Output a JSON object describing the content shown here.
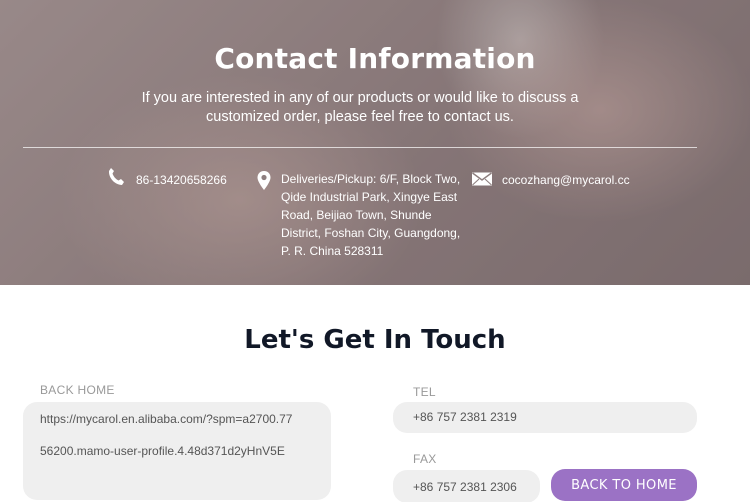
{
  "hero": {
    "title": "Contact Information",
    "subtitle": "If you are interested in any of our products or would like to discuss a customized order, please feel free to contact us.",
    "phone": {
      "icon": "phone-icon",
      "text": "86-13420658266"
    },
    "address": {
      "icon": "map-pin-icon",
      "text": "Deliveries/Pickup:  6/F, Block Two, Qide Industrial Park, Xingye East Road, Beijiao Town, Shunde District, Foshan City, Guangdong, P. R. China 528311"
    },
    "email": {
      "icon": "envelope-icon",
      "text": "cocozhang@mycarol.cc"
    }
  },
  "touch": {
    "title": "Let's Get In Touch",
    "back_home_label": "BACK HOME",
    "back_home_value_line1": "https://mycarol.en.alibaba.com/?spm=a2700.77",
    "back_home_value_line2": "56200.mamo-user-profile.4.48d371d2yHnV5E",
    "tel_label": "TEL",
    "tel_value": "+86 757 2381 2319",
    "fax_label": "FAX",
    "fax_value": "+86 757 2381 2306",
    "back_button": "BACK TO HOME"
  },
  "colors": {
    "accent": "#9b72c5",
    "heading": "#111827",
    "field_bg": "#efefef",
    "label": "#999999"
  }
}
